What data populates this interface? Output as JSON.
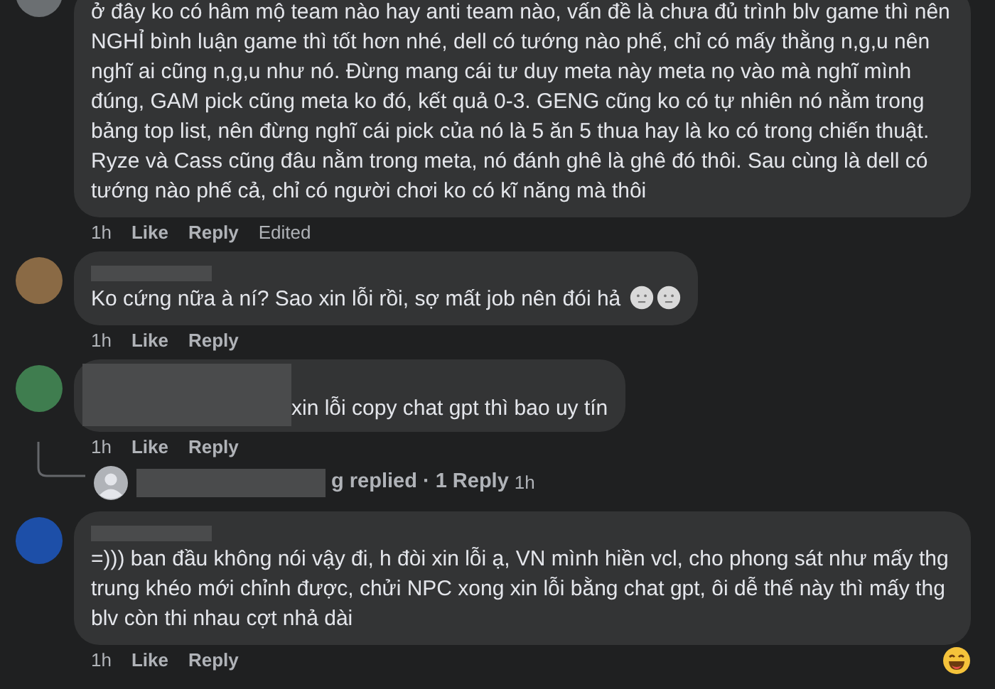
{
  "comments": [
    {
      "kind": "top",
      "text": "ở đây ko có hâm mộ team nào hay anti team nào, vấn đề là chưa đủ trình blv game thì nên NGHỈ bình luận game thì tốt hơn nhé, dell có tướng nào phế, chỉ có mấy thằng n,g,u nên nghĩ ai cũng n,g,u như nó. Đừng mang cái tư duy meta này meta nọ vào mà nghĩ mình đúng, GAM pick cũng meta ko đó, kết quả 0-3. GENG cũng ko có tự nhiên nó nằm trong bảng top list, nên đừng nghĩ cái pick của nó là 5 ăn 5 thua hay là ko có trong chiến thuật. Ryze và Cass cũng đâu nằm trong meta, nó đánh ghê là ghê đó thôi. Sau cùng là dell có tướng nào phế cả, chỉ có người chơi ko có kĩ năng mà thôi",
      "meta": [
        {
          "kind": "time",
          "text": "1h"
        },
        {
          "kind": "action",
          "text": "Like"
        },
        {
          "kind": "action",
          "text": "Reply"
        },
        {
          "kind": "note",
          "text": "Edited"
        }
      ]
    },
    {
      "kind": "named",
      "emoji": true,
      "text": "Ko cứng nữa à ní? Sao xin lỗi rồi, sợ mất job nên đói hả",
      "meta": [
        {
          "kind": "time",
          "text": "1h"
        },
        {
          "kind": "action",
          "text": "Like"
        },
        {
          "kind": "action",
          "text": "Reply"
        }
      ]
    },
    {
      "kind": "inline",
      "text": "xin lỗi copy chat gpt thì bao uy tín",
      "meta": [
        {
          "kind": "time",
          "text": "1h"
        },
        {
          "kind": "action",
          "text": "Like"
        },
        {
          "kind": "action",
          "text": "Reply"
        }
      ],
      "replies_link": {
        "text": "g replied · 1 Reply",
        "time": "1h"
      }
    },
    {
      "kind": "named",
      "text": "=))) ban đầu không nói vậy đi, h đòi xin lỗi ạ, VN mình hiền vcl, cho phong sát như mấy thg trung khéo mới chỉnh được, chửi NPC xong xin lỗi bằng chat gpt, ôi dễ thế này thì mấy thg blv còn thi nhau cợt nhả dài",
      "meta": [
        {
          "kind": "time",
          "text": "1h"
        },
        {
          "kind": "action",
          "text": "Like"
        },
        {
          "kind": "action",
          "text": "Reply"
        }
      ],
      "reaction": true
    }
  ]
}
